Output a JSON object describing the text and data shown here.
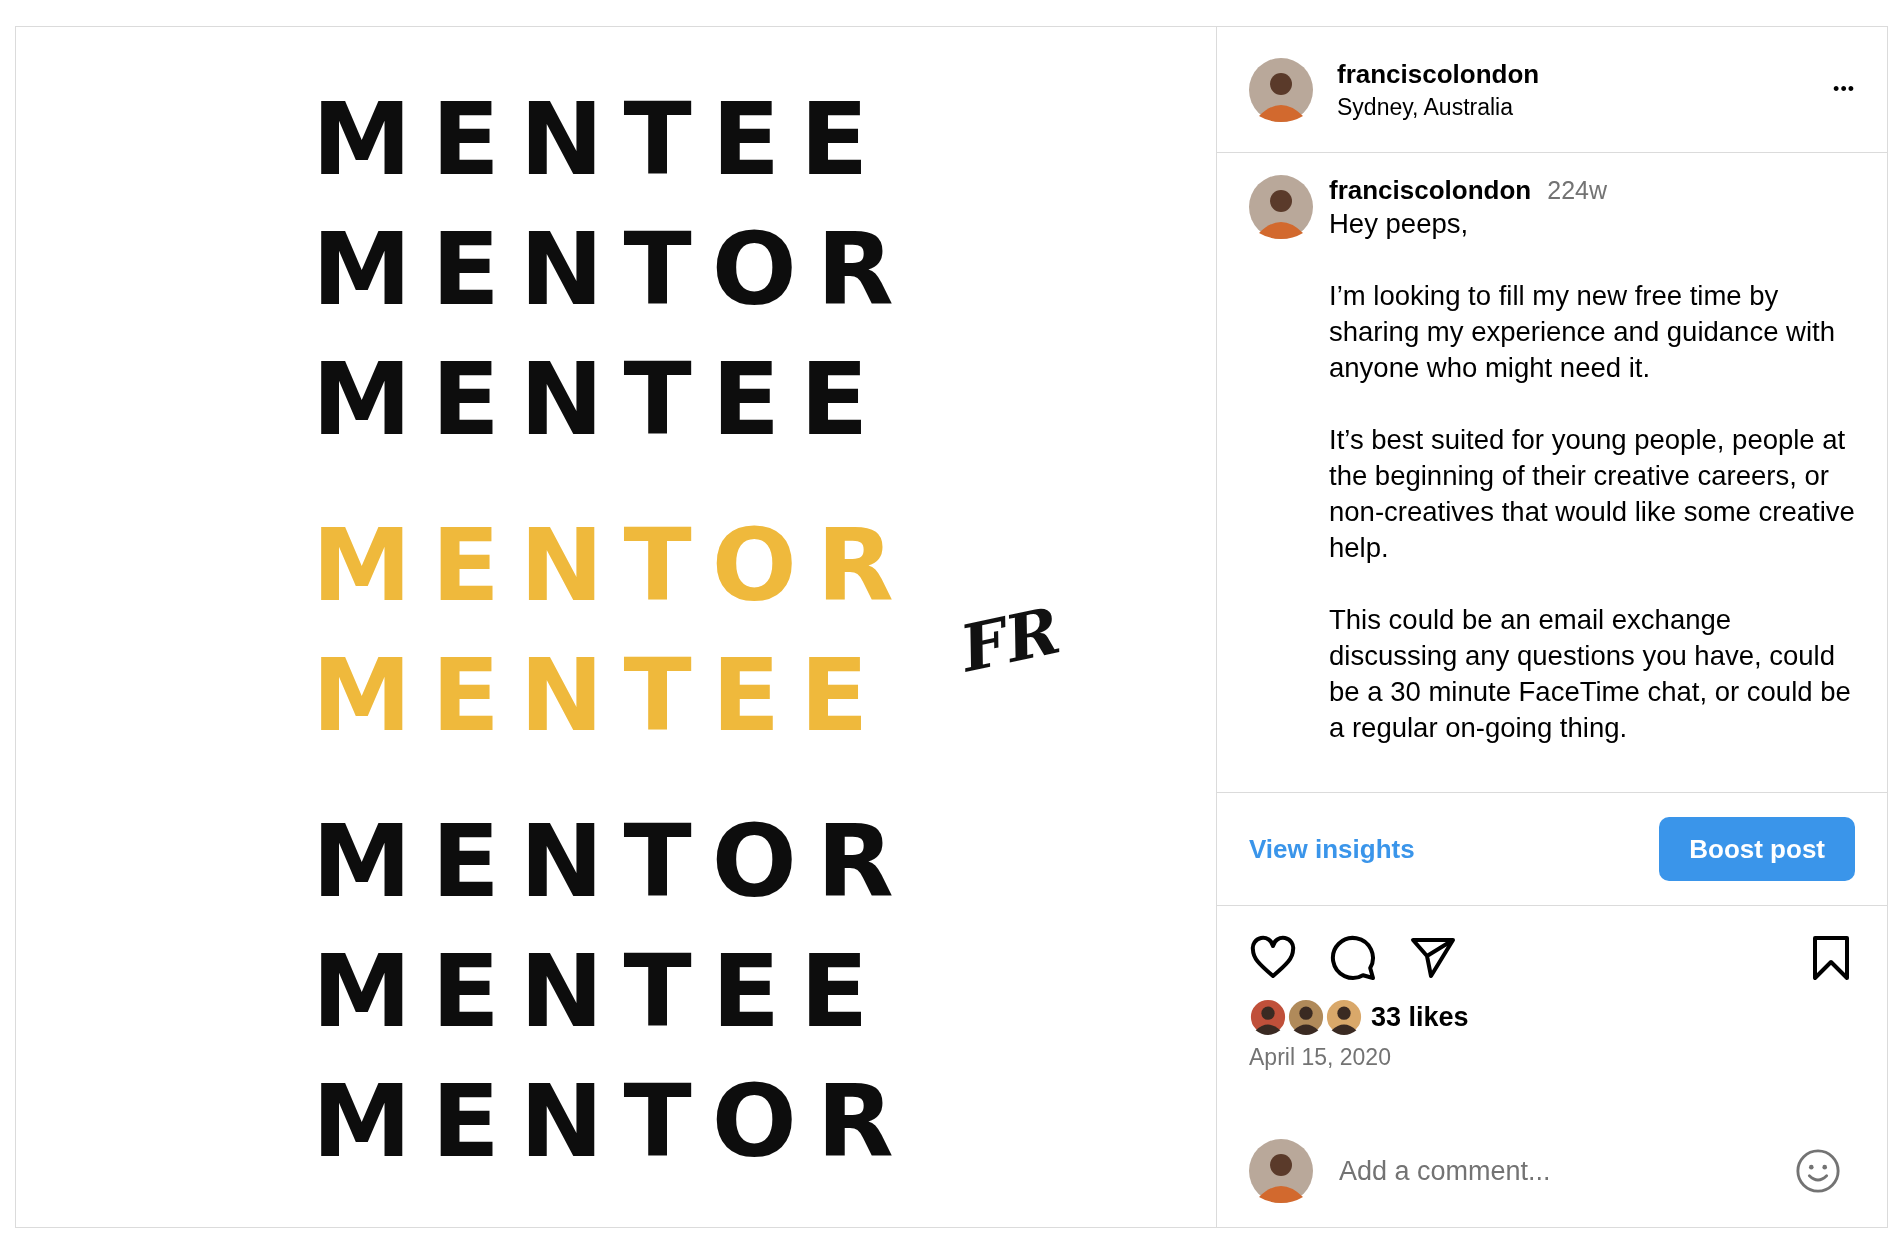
{
  "post_image": {
    "groups": [
      {
        "highlight": false,
        "words": [
          "MENTEE",
          "MENTOR",
          "MENTEE"
        ]
      },
      {
        "highlight": true,
        "words": [
          "MENTOR",
          "MENTEE"
        ]
      },
      {
        "highlight": false,
        "words": [
          "MENTOR",
          "MENTEE",
          "MENTOR"
        ]
      }
    ],
    "signature": "FR"
  },
  "header": {
    "username": "franciscolondon",
    "location": "Sydney, Australia",
    "more": "•••"
  },
  "caption": {
    "username": "franciscolondon",
    "age": "224w",
    "paragraphs": [
      "Hey peeps,",
      "I’m looking to fill my new free time by sharing my experience and guidance with anyone who might need it.",
      "It’s best suited for young people, people at the beginning of their creative careers, or non-creatives that would like some creative help.",
      "This could be an email exchange discussing any questions you have, could be a 30 minute FaceTime chat, or could be a regular on-going thing."
    ]
  },
  "insights": {
    "link": "View insights",
    "button": "Boost post"
  },
  "actions": {
    "liked": false,
    "saved": false
  },
  "likes": {
    "avatars": [
      {
        "color": "#c0503a"
      },
      {
        "color": "#b08a5a"
      },
      {
        "color": "#d9a86a"
      }
    ],
    "text": "33 likes"
  },
  "date": "April 15, 2020",
  "comment": {
    "placeholder": "Add a comment..."
  }
}
